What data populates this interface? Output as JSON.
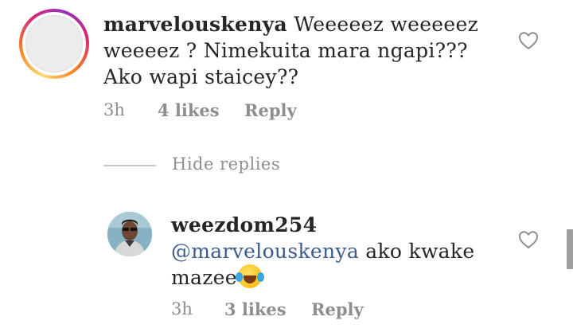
{
  "comment": {
    "username": "marvelouskenya",
    "text": " Weeeeez weeeeez weeeez ? Nimekuita mara ngapi??? Ako wapi staicey??",
    "time": "3h",
    "likes": "4 likes",
    "reply_label": "Reply",
    "like_icon": "heart-outline-icon"
  },
  "hide_replies_label": "Hide replies",
  "reply": {
    "username": "weezdom254",
    "mention": "@marvelouskenya",
    "text": " ako kwake mazee",
    "emoji": "😂",
    "time": "3h",
    "likes": "3 likes",
    "reply_label": "Reply",
    "like_icon": "heart-outline-icon"
  },
  "colors": {
    "text": "#262626",
    "meta": "#8e8e8e",
    "mention": "#3b5c8c"
  }
}
